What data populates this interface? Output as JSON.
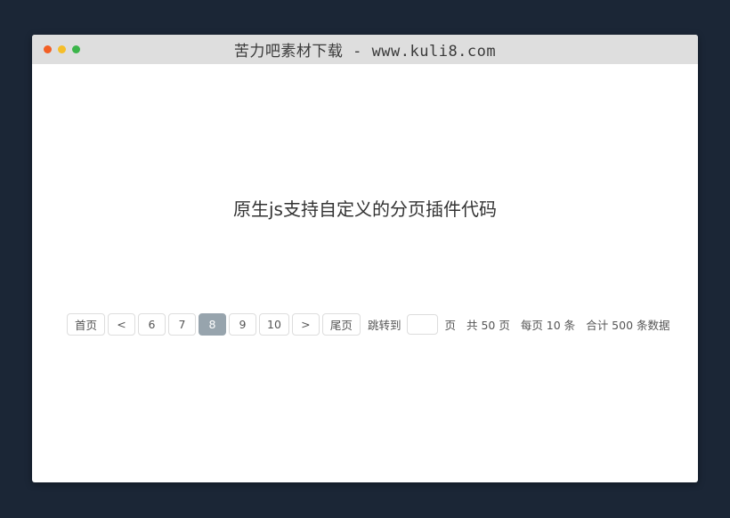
{
  "window": {
    "title": "苦力吧素材下载 - www.kuli8.com"
  },
  "main": {
    "heading": "原生js支持自定义的分页插件代码"
  },
  "pagination": {
    "first_label": "首页",
    "prev_label": "<",
    "pages": [
      "6",
      "7",
      "8",
      "9",
      "10"
    ],
    "current_page": "8",
    "next_label": ">",
    "last_label": "尾页",
    "jump_label": "跳转到",
    "jump_input_value": "",
    "page_unit": "页",
    "total_pages_text": "共 50 页",
    "per_page_text": "每页 10 条",
    "total_records_text": "合计 500 条数据"
  },
  "colors": {
    "background": "#1b2636",
    "titlebar": "#dedede",
    "active_page": "#97a4ad"
  }
}
